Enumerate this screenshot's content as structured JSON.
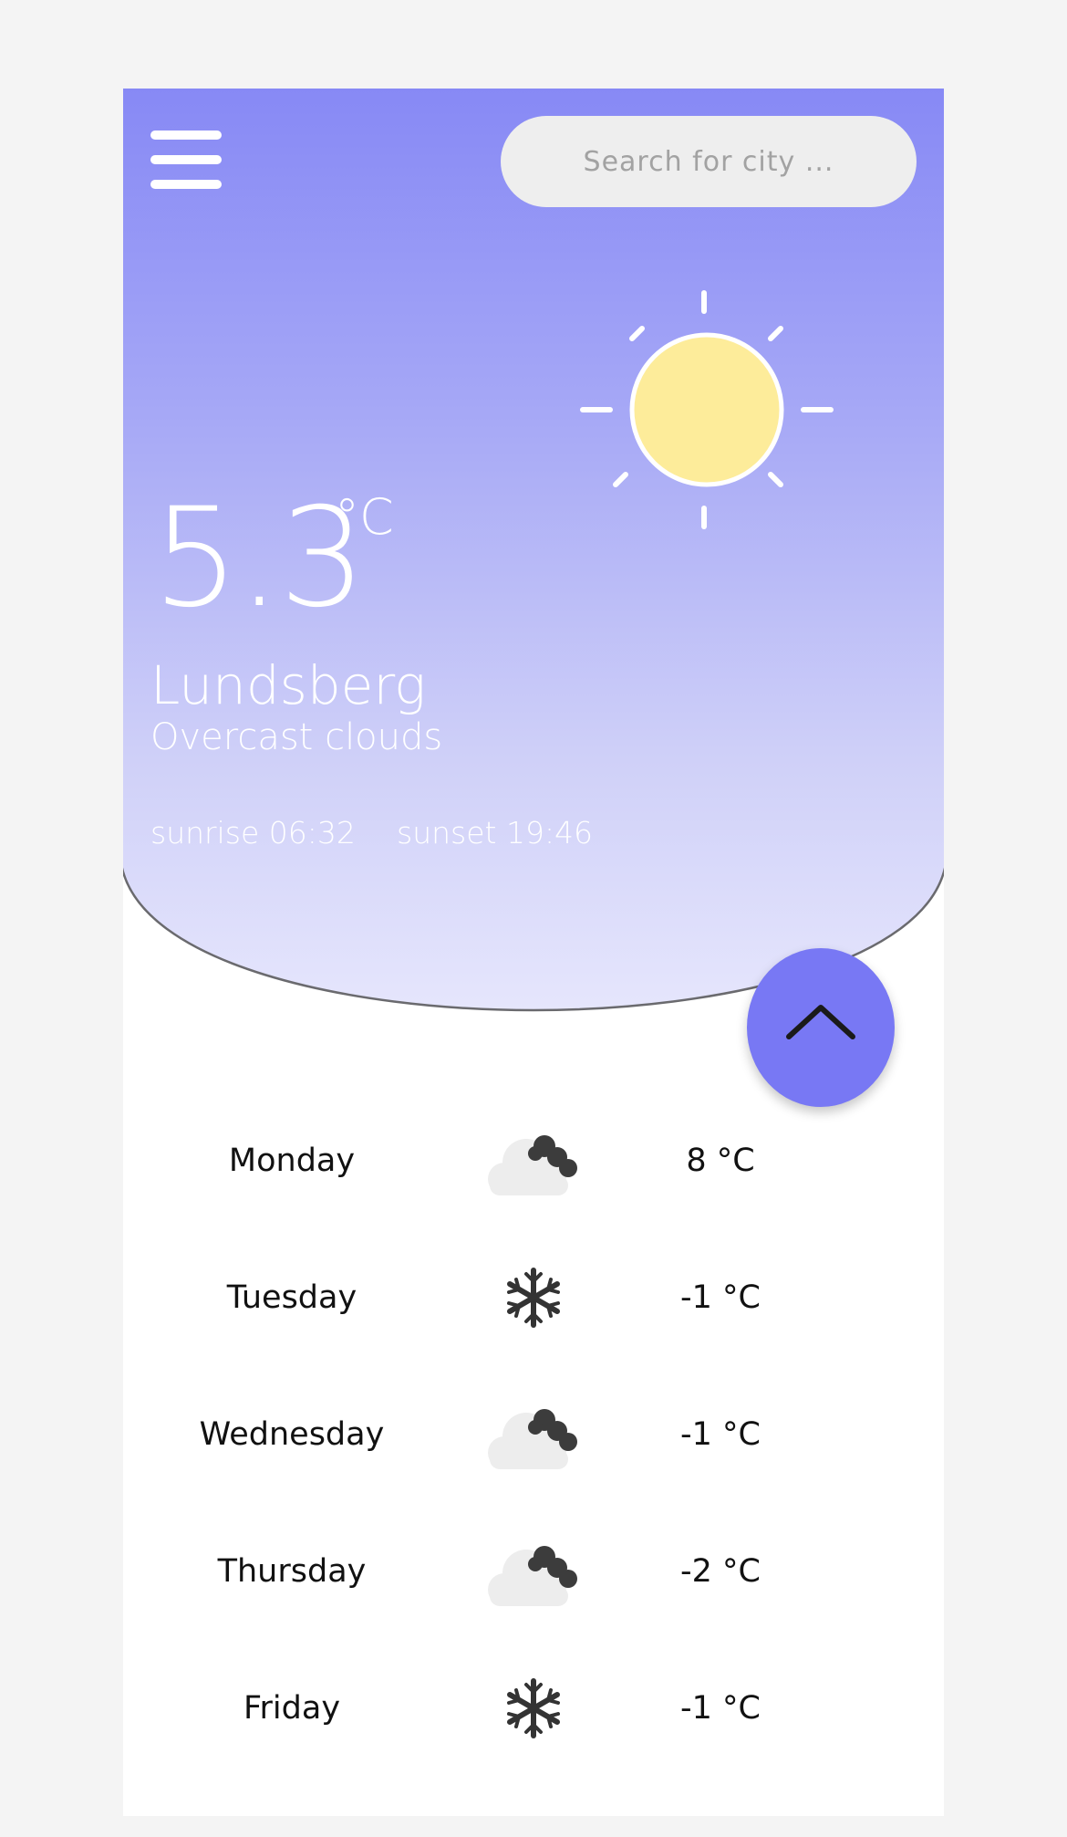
{
  "search": {
    "placeholder": "Search for city ..."
  },
  "current": {
    "temperature": "5.3",
    "unit": "°C",
    "city": "Lundsberg",
    "description": "Overcast clouds",
    "sunrise": "sunrise 06:32",
    "sunset": "sunset 19:46",
    "icon": "sun-icon"
  },
  "forecast": [
    {
      "day": "Monday",
      "icon": "cloud-icon",
      "temp": "8 °C"
    },
    {
      "day": "Tuesday",
      "icon": "snowflake-icon",
      "temp": "-1 °C"
    },
    {
      "day": "Wednesday",
      "icon": "cloud-icon",
      "temp": "-1 °C"
    },
    {
      "day": "Thursday",
      "icon": "cloud-icon",
      "temp": "-2 °C"
    },
    {
      "day": "Friday",
      "icon": "snowflake-icon",
      "temp": "-1 °C"
    }
  ],
  "colors": {
    "gradient_top": "#8789f5",
    "gradient_bottom": "#e9e9fd",
    "accent": "#7878f4",
    "sun": "#fdec9a"
  }
}
